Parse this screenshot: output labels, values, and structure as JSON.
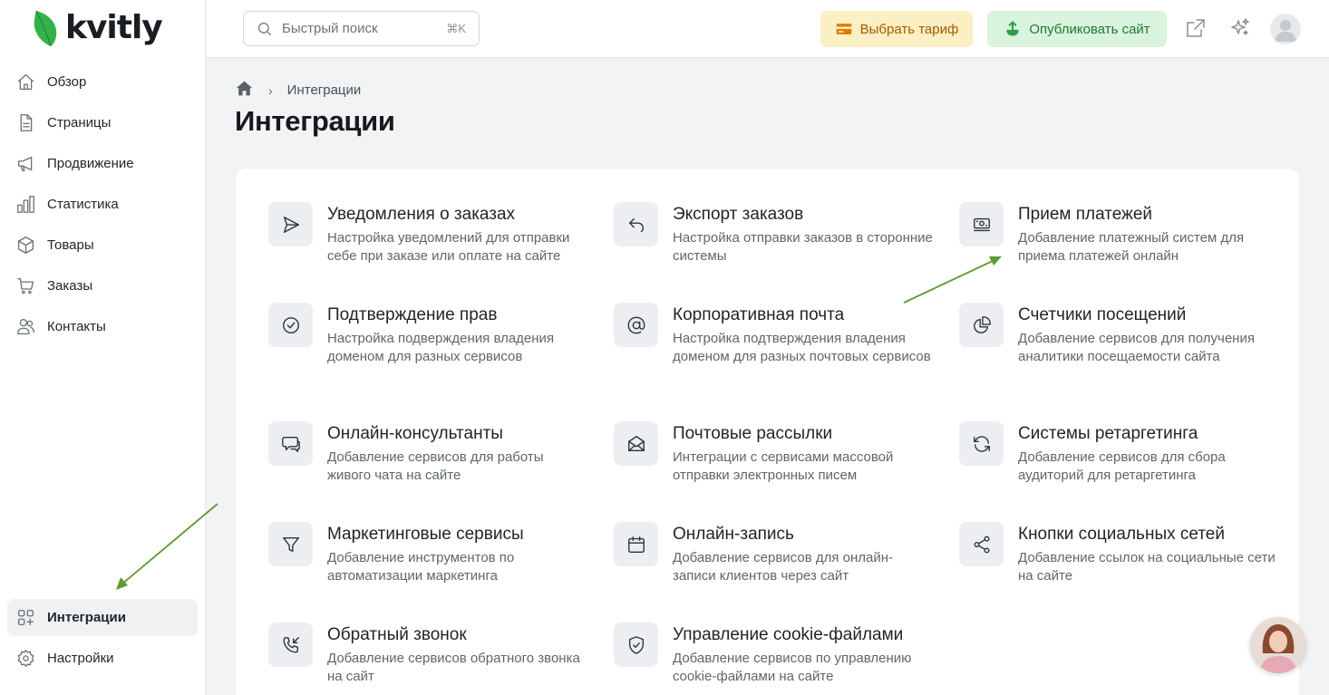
{
  "brand": {
    "name": "kvitly",
    "leaf_color": "#34b24a"
  },
  "sidebar": {
    "items": [
      {
        "label": "Обзор",
        "icon": "home-icon"
      },
      {
        "label": "Страницы",
        "icon": "page-icon"
      },
      {
        "label": "Продвижение",
        "icon": "megaphone-icon"
      },
      {
        "label": "Статистика",
        "icon": "bar-chart-icon"
      },
      {
        "label": "Товары",
        "icon": "box-icon"
      },
      {
        "label": "Заказы",
        "icon": "cart-icon"
      },
      {
        "label": "Контакты",
        "icon": "users-icon"
      }
    ],
    "bottom": [
      {
        "label": "Интеграции",
        "icon": "integrations-icon",
        "active": true
      },
      {
        "label": "Настройки",
        "icon": "gear-icon"
      }
    ]
  },
  "topbar": {
    "search_placeholder": "Быстрый поиск",
    "search_shortcut": "⌘K",
    "tariff_label": "Выбрать тариф",
    "publish_label": "Опубликовать сайт"
  },
  "breadcrumb": {
    "current": "Интеграции"
  },
  "page": {
    "title": "Интеграции"
  },
  "integrations": [
    {
      "title": "Уведомления о заказах",
      "desc": "Настройка уведомлений для отправки себе при заказе или оплате на сайте",
      "icon": "send-icon"
    },
    {
      "title": "Экспорт заказов",
      "desc": "Настройка отправки заказов в сторонние системы",
      "icon": "export-icon"
    },
    {
      "title": "Прием платежей",
      "desc": "Добавление платежный систем для приема платежей онлайн",
      "icon": "payment-icon"
    },
    {
      "title": "Подтверждение прав",
      "desc": "Настройка подверждения владения доменом для разных сервисов",
      "icon": "check-circle-icon"
    },
    {
      "title": "Корпоративная почта",
      "desc": "Настройка подтверждения владения доменом для разных почтовых сервисов",
      "icon": "at-icon"
    },
    {
      "title": "Счетчики посещений",
      "desc": "Добавление сервисов для получения аналитики посещаемости сайта",
      "icon": "pie-chart-icon"
    },
    {
      "title": "Онлайн-консультанты",
      "desc": "Добавление сервисов для работы живого чата на сайте",
      "icon": "chat-icon"
    },
    {
      "title": "Почтовые рассылки",
      "desc": "Интеграции с сервисами массовой отправки электронных писем",
      "icon": "mail-open-icon"
    },
    {
      "title": "Системы ретаргетинга",
      "desc": "Добавление сервисов для сбора аудиторий для ретаргетинга",
      "icon": "refresh-icon"
    },
    {
      "title": "Маркетинговые сервисы",
      "desc": "Добавление инструментов по автоматизации маркетинга",
      "icon": "funnel-icon"
    },
    {
      "title": "Онлайн-запись",
      "desc": "Добавление сервисов для онлайн-записи клиентов через сайт",
      "icon": "calendar-icon"
    },
    {
      "title": "Кнопки социальных сетей",
      "desc": "Добавление ссылок на социальные сети на сайте",
      "icon": "share-icon"
    },
    {
      "title": "Обратный звонок",
      "desc": "Добавление сервисов обратного звонка на сайт",
      "icon": "phone-callback-icon"
    },
    {
      "title": "Управление cookie-файлами",
      "desc": "Добавление сервисов по управлению cookie-файлами на сайте",
      "icon": "shield-check-icon"
    }
  ],
  "colors": {
    "accent_green": "#34b24a",
    "tariff_bg": "#fbefc4",
    "publish_bg": "#d9f3dd",
    "arrow": "#5f9a32"
  }
}
